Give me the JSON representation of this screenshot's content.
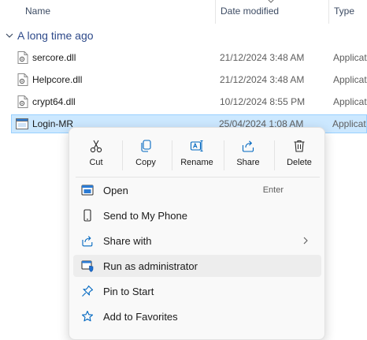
{
  "columns": {
    "name": "Name",
    "date": "Date modified",
    "type": "Type"
  },
  "group": {
    "title": "A long time ago"
  },
  "files": [
    {
      "name": "sercore.dll",
      "date": "21/12/2024 3:48 AM",
      "type": "Applicat",
      "icon": "dll-file-icon"
    },
    {
      "name": "Helpcore.dll",
      "date": "21/12/2024 3:48 AM",
      "type": "Applicat",
      "icon": "dll-file-icon"
    },
    {
      "name": "crypt64.dll",
      "date": "10/12/2024 8:55 PM",
      "type": "Applicat",
      "icon": "dll-file-icon"
    },
    {
      "name": "Login-MR",
      "date": "25/04/2024 1:08 AM",
      "type": "Applicat",
      "icon": "application-exe-icon",
      "selected": true
    }
  ],
  "context_menu": {
    "quick_actions": [
      {
        "label": "Cut",
        "icon": "cut-icon"
      },
      {
        "label": "Copy",
        "icon": "copy-icon"
      },
      {
        "label": "Rename",
        "icon": "rename-icon"
      },
      {
        "label": "Share",
        "icon": "share-icon"
      },
      {
        "label": "Delete",
        "icon": "delete-icon"
      }
    ],
    "items": [
      {
        "label": "Open",
        "shortcut": "Enter",
        "icon": "open-window-icon"
      },
      {
        "label": "Send to My Phone",
        "icon": "phone-icon"
      },
      {
        "label": "Share with",
        "icon": "share-with-icon",
        "submenu": true
      },
      {
        "label": "Run as administrator",
        "icon": "uac-shield-icon",
        "hovered": true
      },
      {
        "label": "Pin to Start",
        "icon": "pin-icon"
      },
      {
        "label": "Add to Favorites",
        "icon": "star-icon"
      }
    ]
  },
  "colors": {
    "accent": "#0067c0",
    "selection": "#cce8ff",
    "selection_border": "#99d1ff",
    "group_title": "#2e4a8a"
  }
}
